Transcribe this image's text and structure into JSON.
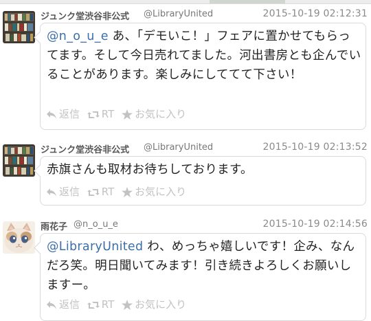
{
  "tweets": [
    {
      "name": "ジュンク堂渋谷非公式",
      "handle": "@LibraryUnited",
      "time": "2015-10-19 02:12:31",
      "mention": "@n_o_u_e",
      "text": " あ、「デモいこ！」フェアに置かせてもらってます。そして今日売れてました。河出書房とも企んでいることがあります。楽しみにしててて下さい！",
      "avatar_icon": "bookshelf-avatar"
    },
    {
      "name": "ジュンク堂渋谷非公式",
      "handle": "@LibraryUnited",
      "time": "2015-10-19 02:13:52",
      "mention": "",
      "text": "赤旗さんも取材お待ちしております。",
      "avatar_icon": "bookshelf-avatar"
    },
    {
      "name": "雨花子",
      "handle": "@n_o_u_e",
      "time": "2015-10-19 02:14:56",
      "mention": "@LibraryUnited",
      "text": " わ、めっちゃ嬉しいです！企み、なんだろ笑。明日聞いてみます！引き続きよろしくお願いしますー。",
      "avatar_icon": "kitten-avatar"
    }
  ],
  "actions": {
    "reply": "返信",
    "retweet": "RT",
    "favorite": "お気に入り"
  },
  "colors": {
    "mention": "#3b6fa8",
    "action_gray": "#c2c2c2",
    "text": "#222222"
  }
}
